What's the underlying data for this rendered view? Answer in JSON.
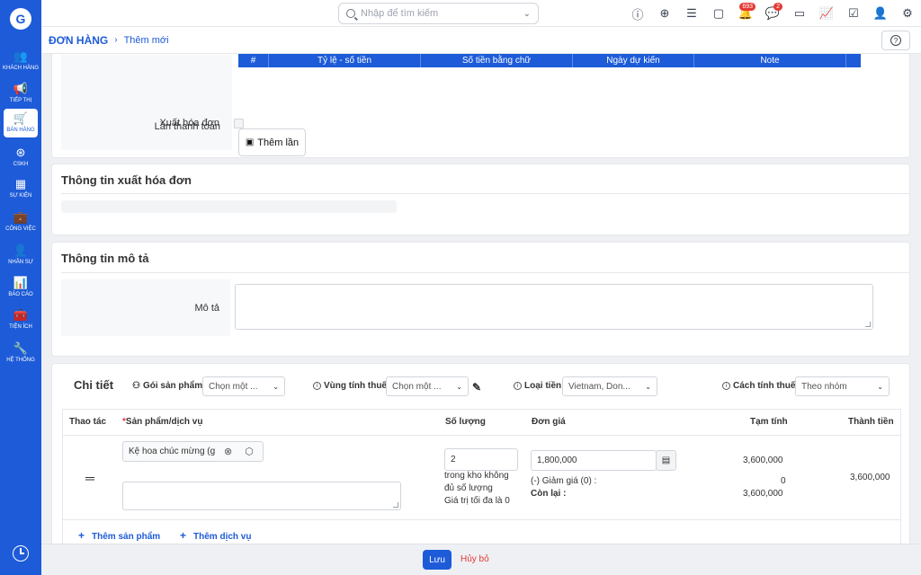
{
  "sidebar": {
    "logo": "G",
    "items": [
      {
        "label": "Khách hàng",
        "icon": "customers-icon",
        "glyph": "👥",
        "active": false
      },
      {
        "label": "Tiếp thị",
        "icon": "megaphone-icon",
        "glyph": "📢",
        "active": false
      },
      {
        "label": "Bán hàng",
        "icon": "cart-icon",
        "glyph": "🛒",
        "active": true
      },
      {
        "label": "CSKH",
        "icon": "lifebuoy-icon",
        "glyph": "⊛",
        "active": false
      },
      {
        "label": "Sự kiện",
        "icon": "calendar-icon",
        "glyph": "▦",
        "active": false
      },
      {
        "label": "Công việc",
        "icon": "briefcase-icon",
        "glyph": "💼",
        "active": false
      },
      {
        "label": "Nhân sự",
        "icon": "person-icon",
        "glyph": "👤",
        "active": false
      },
      {
        "label": "Báo cáo",
        "icon": "report-icon",
        "glyph": "📊",
        "active": false
      },
      {
        "label": "Tiện ích",
        "icon": "utility-icon",
        "glyph": "🧰",
        "active": false
      },
      {
        "label": "Hệ thống",
        "icon": "wrench-icon",
        "glyph": "🔧",
        "active": false
      }
    ]
  },
  "header": {
    "search_placeholder": "Nhập để tìm kiếm",
    "notifications_count": "693",
    "messages_count": "2"
  },
  "breadcrumb": {
    "main": "ĐƠN HÀNG",
    "sub": "Thêm mới"
  },
  "payment": {
    "columns": [
      "#",
      "Tỷ lệ - số tiền",
      "Số tiền bằng chữ",
      "Ngày dự kiến",
      "Note"
    ],
    "label": "Lần thanh toán",
    "add_button": "Thêm lần",
    "invoice_label": "Xuất hóa đơn"
  },
  "invoice_section": {
    "title": "Thông tin xuất hóa đơn"
  },
  "description_section": {
    "title": "Thông tin mô tả",
    "field_label": "Mô tả",
    "field_value": ""
  },
  "detail": {
    "title": "Chi tiết",
    "package_label": "Gói sản phẩm",
    "package_value": "Chọn một ...",
    "tax_zone_label": "Vùng tính thuế",
    "tax_zone_value": "Chọn một ...",
    "currency_label": "Loại tiền",
    "currency_value": "Vietnam, Don...",
    "tax_method_label": "Cách tính thuế",
    "tax_method_value": "Theo nhóm",
    "columns": {
      "action": "Thao tác",
      "product": "Sản phẩm/dịch vụ",
      "quantity": "Số lượng",
      "unit_price": "Đơn giá",
      "subtotal": "Tạm tính",
      "total": "Thành tiền"
    },
    "row": {
      "product": "Kệ hoa chúc mừng (gi",
      "quantity": "2",
      "stock_warning_1": "trong kho không",
      "stock_warning_2": "đủ số lượng",
      "stock_warning_3": "Giá trị tối đa là 0",
      "unit_price": "1,800,000",
      "subtotal": "3,600,000",
      "discount_label": "(-) Giảm giá (0) :",
      "discount_value": "0",
      "remaining_label": "Còn lại :",
      "remaining_value": "3,600,000",
      "total": "3,600,000"
    },
    "add_product": "Thêm sản phẩm",
    "add_service": "Thêm dịch vụ"
  },
  "footer": {
    "save": "Lưu",
    "cancel": "Hủy bỏ"
  }
}
